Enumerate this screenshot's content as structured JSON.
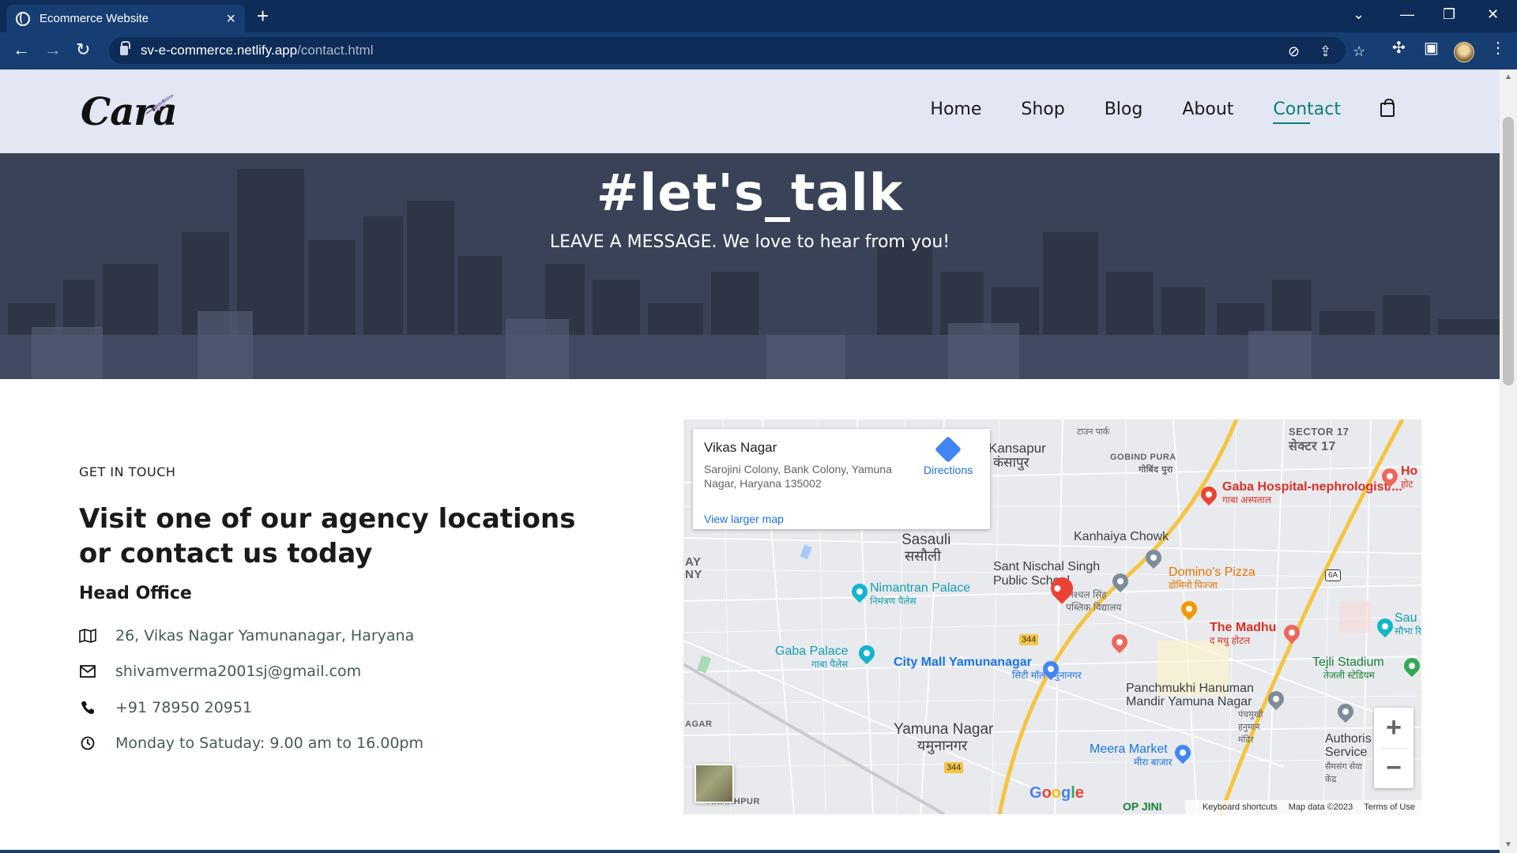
{
  "browser": {
    "tab_title": "Ecommerce Website",
    "url_domain": "sv-e-commerce.netlify.app",
    "url_path": "/contact.html"
  },
  "site": {
    "logo": "Cara",
    "nav": [
      "Home",
      "Shop",
      "Blog",
      "About",
      "Contact"
    ],
    "active_nav": "Contact",
    "accent_color": "#088178"
  },
  "hero": {
    "title": "#let's_talk",
    "subtitle": "LEAVE A MESSAGE. We love to hear from you!"
  },
  "contact": {
    "eyebrow": "GET IN TOUCH",
    "heading": "Visit one of our agency locations or contact us today",
    "office_title": "Head Office",
    "items": [
      {
        "icon": "map-icon",
        "text": "26, Vikas Nagar Yamunanagar, Haryana"
      },
      {
        "icon": "envelope-icon",
        "text": "shivamverma2001sj@gmail.com"
      },
      {
        "icon": "phone-icon",
        "text": "+91 78950 20951"
      },
      {
        "icon": "clock-icon",
        "text": "Monday to Satuday: 9.00 am to 16.00pm"
      }
    ]
  },
  "map": {
    "place_name": "Vikas Nagar",
    "place_address": "Sarojini Colony, Bank Colony, Yamuna Nagar, Haryana 135002",
    "directions": "Directions",
    "larger_map": "View larger map",
    "labels": {
      "sector17": "SECTOR 17",
      "sector17_hi": "सेक्टर 17",
      "kansapur": "Kansapur",
      "kansapur_hi": "कंसापुर",
      "gobind_pura": "GOBIND PURA",
      "gobind_pura_hi": "गोबिंद पुरा",
      "town_park": "टाउन पार्क",
      "gaba_hospital": "Gaba Hospital-nephrologist/...",
      "gaba_hospital_hi": "गाबा अस्पताल",
      "ho": "Ho",
      "ho_hi": "होट",
      "kanhaiya_chowk": "Kanhaiya Chowk",
      "sasauli": "Sasauli",
      "sasauli_hi": "ससौली",
      "sant_nischal": "Sant Nischal Singh Public School",
      "sant_nischal_hi": "निश्चल सिंह पब्लिक विद्यालय",
      "dominos": "Domino's Pizza",
      "dominos_hi": "डोमिनो पिज्जा",
      "nimantran": "Nimantran Palace",
      "nimantran_hi": "निमंत्रण पैलेस",
      "the_madhu": "The Madhu",
      "the_madhu_hi": "द मधु होटल",
      "sau": "Sau",
      "sau_hi": "सौभा रिसॉर्ट",
      "gaba_palace": "Gaba Palace",
      "gaba_palace_hi": "गाबा पैलेस",
      "city_mall": "City Mall Yamunanagar",
      "city_mall_hi": "सिटी मॉल यमुनानगर",
      "tejli": "Tejli Stadium",
      "tejli_hi": "तेजली स्टेडियम",
      "panchmukhi": "Panchmukhi Hanuman Mandir Yamuna Nagar",
      "panchmukhi_hi": "पंचमुखी हनुमान मंदिर",
      "authoris": "Authoris Service",
      "authoris_hi": "सैमसंग सेवा केंद्र",
      "yamuna_nagar": "Yamuna Nagar",
      "yamuna_nagar_hi": "यमुनानगर",
      "meera_market": "Meera Market",
      "meera_market_hi": "मीरा बाजार",
      "ay": "AY",
      "ny": "NY",
      "agar": "AGAR",
      "arakhpur": "ARAKHPUR",
      "op_jin": "OP JINI",
      "road_344": "344",
      "road_6a": "6A"
    },
    "footer": {
      "keyboard": "Keyboard shortcuts",
      "map_data": "Map data ©2023",
      "terms": "Terms of Use"
    },
    "google": "Google"
  }
}
